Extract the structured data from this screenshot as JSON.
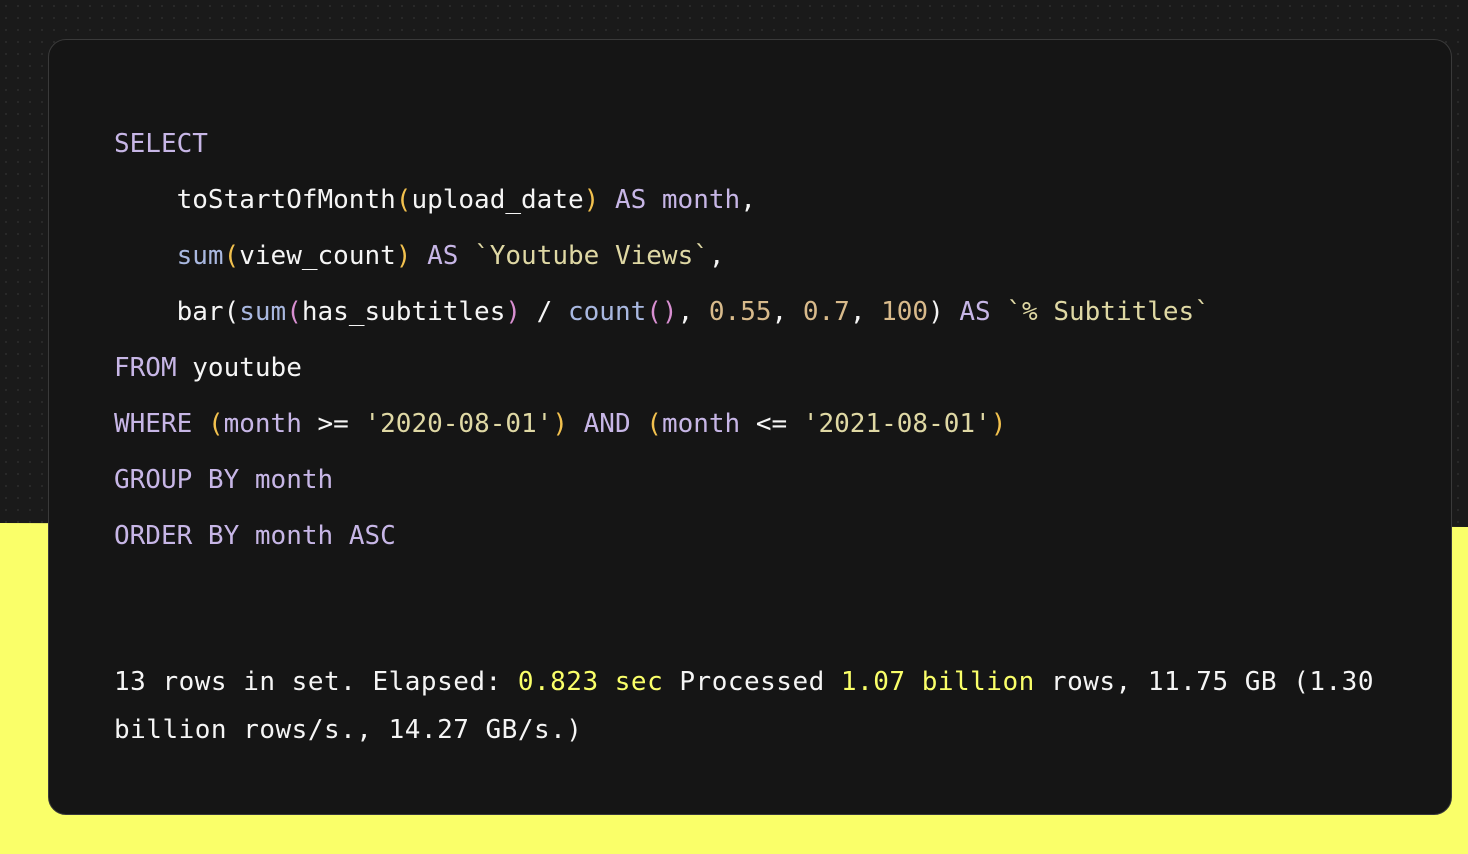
{
  "colors": {
    "background": "#1a1a1a",
    "panel": "#151515",
    "accent": "#faff69",
    "keyword": "#c7b6e6",
    "function": "#a9b8e0",
    "string": "#dfd8a4",
    "number": "#d8ba8b"
  },
  "query": {
    "line1": {
      "select_kw": "SELECT"
    },
    "line2": {
      "fn": "toStartOfMonth",
      "open": "(",
      "arg": "upload_date",
      "close": ")",
      "as_kw": "AS",
      "alias": "month",
      "comma": ","
    },
    "line3": {
      "fn": "sum",
      "open": "(",
      "arg": "view_count",
      "close": ")",
      "as_kw": "AS",
      "alias": "`Youtube Views`",
      "comma": ","
    },
    "line4": {
      "fn": "bar",
      "open": "(",
      "inner_fn": "sum",
      "inner_open": "(",
      "inner_arg": "has_subtitles",
      "inner_close": ")",
      "slash": " / ",
      "count_fn": "count",
      "count_parens": "()",
      "comma1": ", ",
      "n1": "0.55",
      "comma2": ", ",
      "n2": "0.7",
      "comma3": ", ",
      "n3": "100",
      "close": ")",
      "as_kw": "AS",
      "alias": "`% Subtitles`"
    },
    "line5": {
      "from_kw": "FROM",
      "table": "youtube"
    },
    "line6": {
      "where_kw": "WHERE",
      "open1": "(",
      "col1": "month",
      "op1": " >= ",
      "val1": "'2020-08-01'",
      "close1": ")",
      "and_kw": "AND",
      "open2": "(",
      "col2": "month",
      "op2": " <= ",
      "val2": "'2021-08-01'",
      "close2": ")"
    },
    "line7": {
      "group_kw": "GROUP BY",
      "col": "month"
    },
    "line8": {
      "order_kw": "ORDER BY",
      "col": "month",
      "dir_kw": "ASC"
    }
  },
  "result": {
    "prefix": "13 rows in set. Elapsed: ",
    "elapsed": "0.823 sec",
    "mid": " Processed ",
    "rows": "1.07 billion",
    "suffix": " rows, 11.75 GB (1.30 billion rows/s., 14.27 GB/s.)"
  }
}
